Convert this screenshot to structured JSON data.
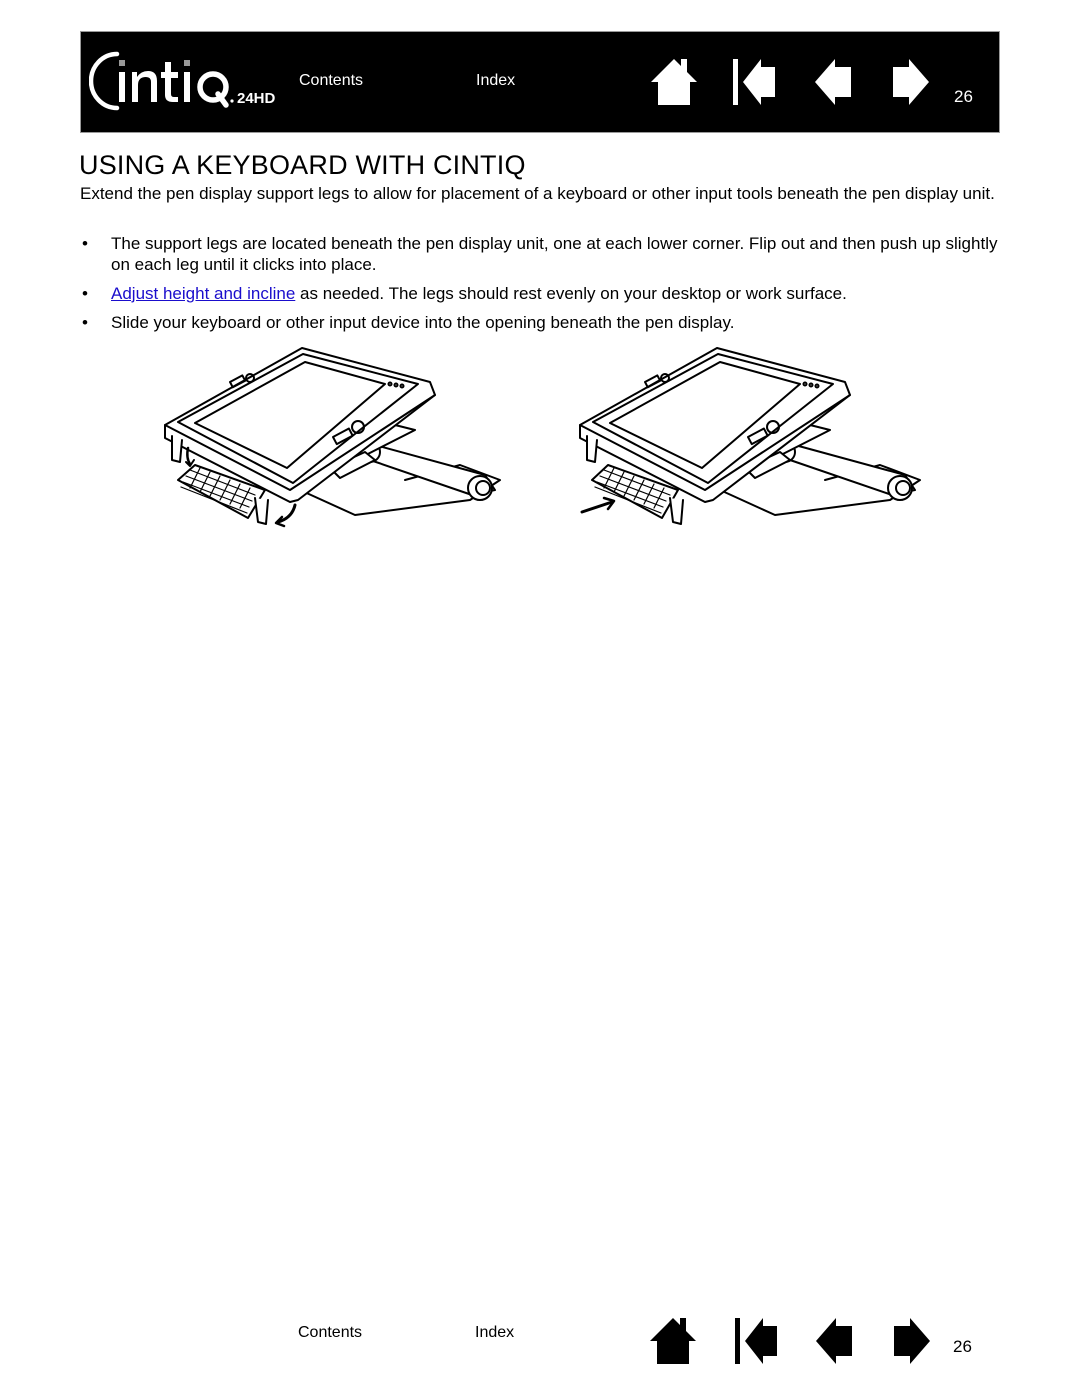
{
  "header": {
    "logo_text": "Cintiq",
    "logo_model": "24HD",
    "contents_label": "Contents",
    "index_label": "Index",
    "page_number": "26",
    "nav_icons": [
      "home-icon",
      "first-page-icon",
      "previous-page-icon",
      "next-page-icon"
    ]
  },
  "content": {
    "title": "USING A KEYBOARD WITH CINTIQ",
    "intro": "Extend the pen display support legs to allow for placement of a keyboard or other input tools beneath the pen display unit.",
    "bullets": [
      {
        "text": "The support legs are located beneath the pen display unit, one at each lower corner.  Flip out and then push up slightly on each leg until it clicks into place."
      },
      {
        "link": "Adjust height and incline",
        "text": " as needed.  The legs should rest evenly on your desktop or work surface."
      },
      {
        "text": "Slide your keyboard or other input device into the opening beneath the pen display."
      }
    ],
    "bullet_glyph": "•",
    "link_color": "#1a0dcc",
    "figures": [
      {
        "description": "Pen display with support legs flipping out, arrows showing leg rotation"
      },
      {
        "description": "Pen display with keyboard sliding underneath, arrow showing insertion direction"
      }
    ]
  },
  "footer": {
    "contents_label": "Contents",
    "index_label": "Index",
    "page_number": "26"
  }
}
